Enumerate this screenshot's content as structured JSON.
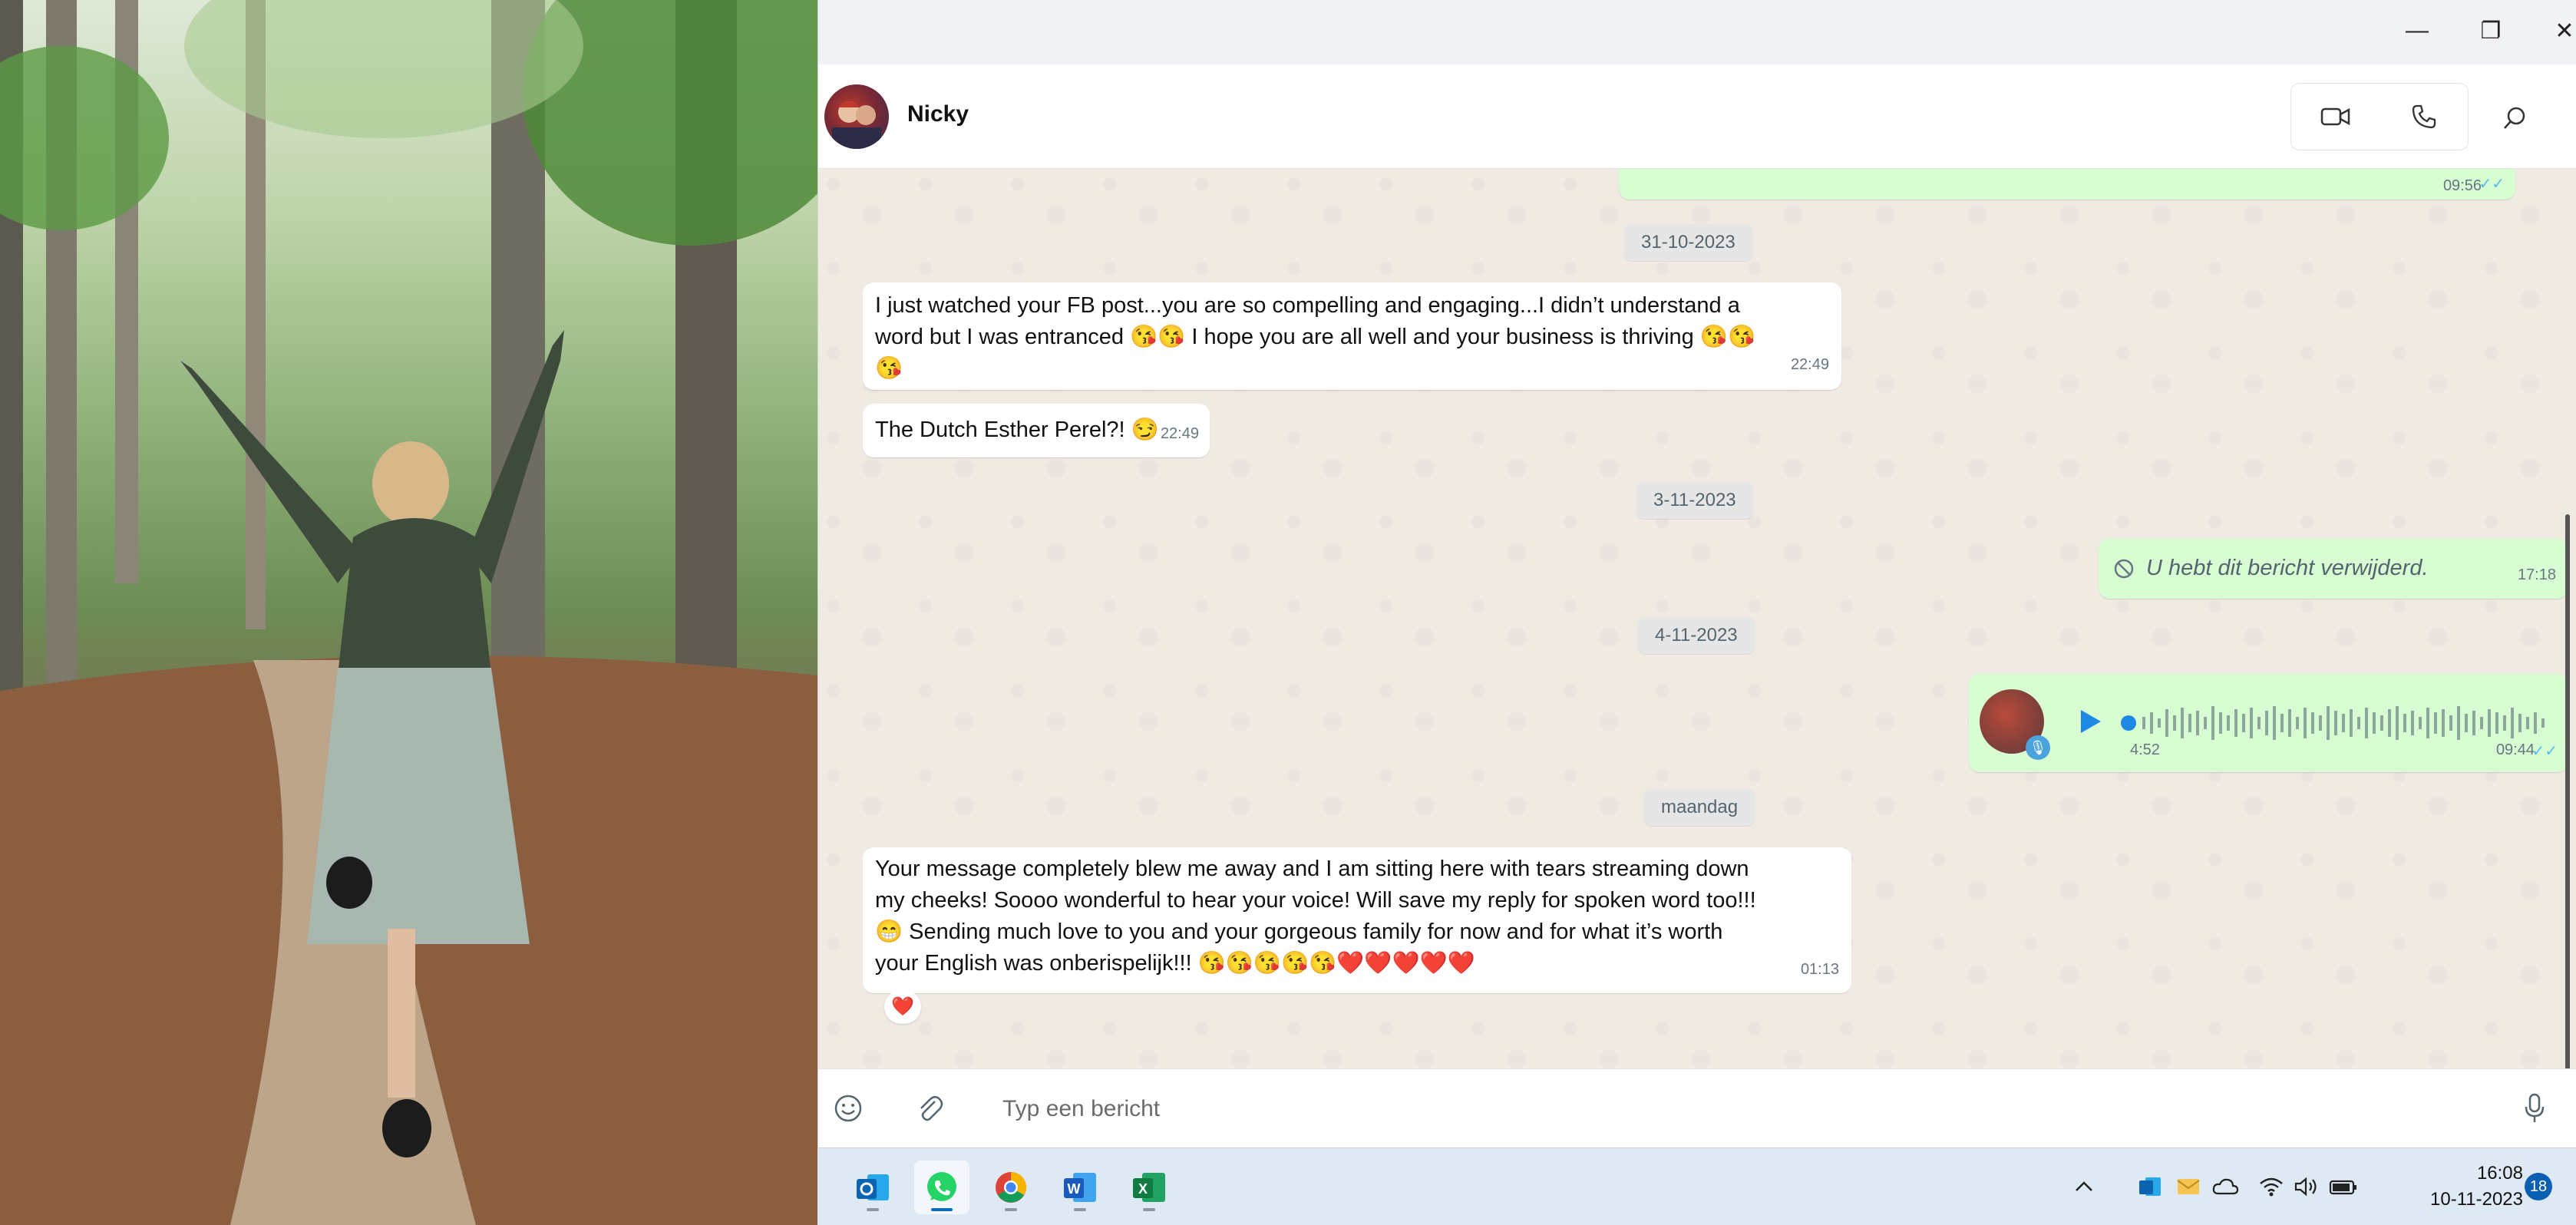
{
  "window": {
    "controls": {
      "minimize": "—",
      "maximize": "❐",
      "close": "✕"
    }
  },
  "chat": {
    "contact_name": "Nicky",
    "messages_area": {
      "prev_out_time": "09:56",
      "date_1": "31-10-2023",
      "msg1_lines": [
        "I just watched your FB post...you are so compelling and engaging...I didn’t understand a",
        "word but I was entranced 😘😘 I hope you are all well and your business is thriving 😘😘",
        "😘"
      ],
      "msg1_time": "22:49",
      "msg2_text": "The Dutch Esther Perel?! 😏",
      "msg2_time": "22:49",
      "date_2": "3-11-2023",
      "deleted_text": "U hebt dit bericht verwijderd.",
      "deleted_time": "17:18",
      "date_3": "4-11-2023",
      "voice_duration": "4:52",
      "voice_time": "09:44",
      "date_4": "maandag",
      "msg3_lines": [
        "Your message completely blew me away and I am sitting here with tears streaming down",
        "my cheeks! Soooo wonderful to hear your voice! Will save my reply for spoken word too!!!",
        "😁 Sending much love to you and your gorgeous family for now and for what it’s worth",
        "your English was onberispelijk!!! 😘😘😘😘😘❤️❤️❤️❤️❤️"
      ],
      "msg3_time": "01:13",
      "msg3_reaction": "❤️"
    }
  },
  "composer": {
    "placeholder": "Typ een bericht"
  },
  "taskbar": {
    "apps": [
      "outlook-icon",
      "whatsapp-icon",
      "chrome-icon",
      "word-icon",
      "excel-icon"
    ],
    "clock_time": "16:08",
    "clock_date": "10-11-2023",
    "notification_count": "18"
  },
  "colors": {
    "outgoing_bubble": "#d9fdd3",
    "incoming_bubble": "#ffffff",
    "chat_bg": "#efeae2",
    "read_ticks": "#53bdeb",
    "whatsapp_green": "#25d366"
  }
}
